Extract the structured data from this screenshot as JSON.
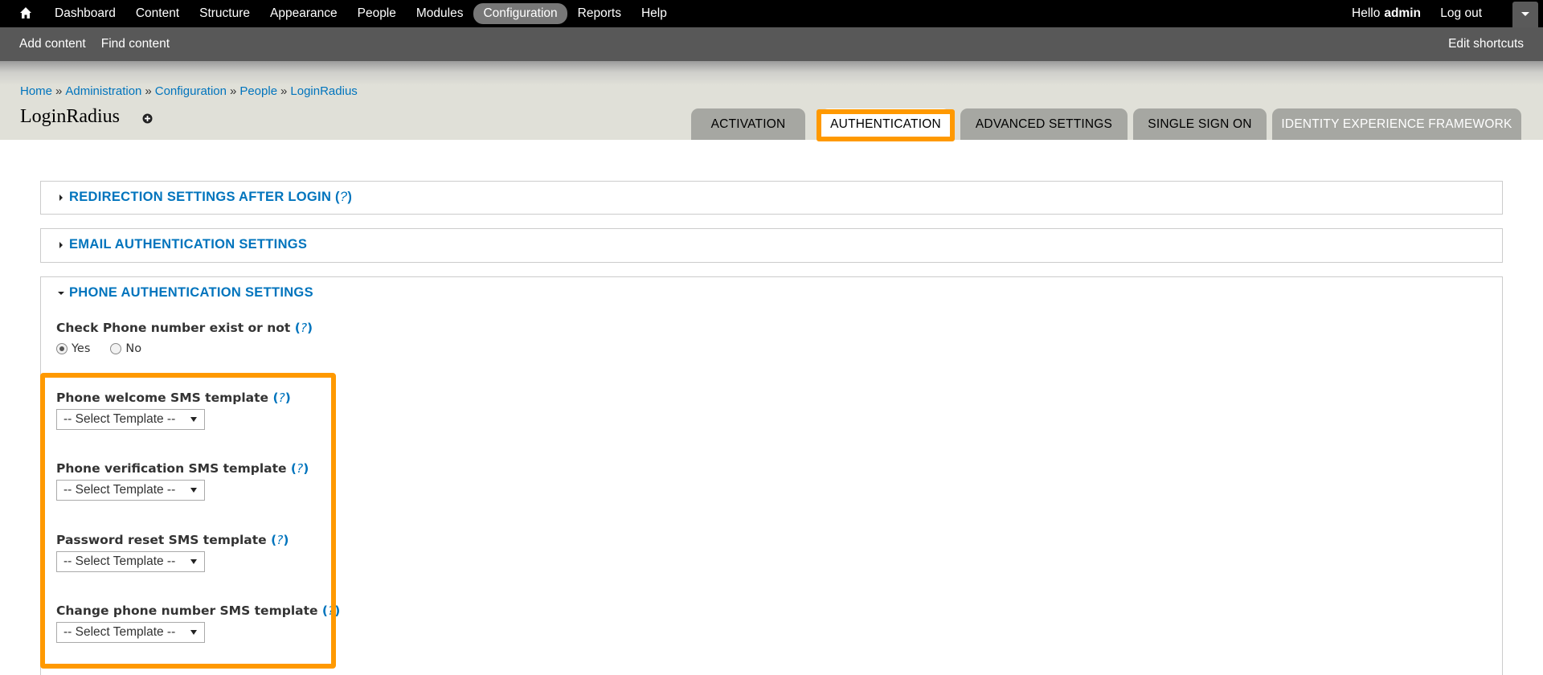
{
  "toolbar": {
    "nav": [
      "Dashboard",
      "Content",
      "Structure",
      "Appearance",
      "People",
      "Modules",
      "Configuration",
      "Reports",
      "Help"
    ],
    "active": "Configuration",
    "hello": "Hello",
    "username": "admin",
    "logout": "Log out"
  },
  "shortcuts": {
    "add_content": "Add content",
    "find_content": "Find content",
    "edit_shortcuts": "Edit shortcuts"
  },
  "breadcrumb": {
    "items": [
      "Home",
      "Administration",
      "Configuration",
      "People",
      "LoginRadius"
    ],
    "separator": "»"
  },
  "page_title": "LoginRadius",
  "tabs": [
    "ACTIVATION",
    "AUTHENTICATION",
    "ADVANCED SETTINGS",
    "SINGLE SIGN ON",
    "IDENTITY EXPERIENCE FRAMEWORK"
  ],
  "active_tab": "AUTHENTICATION",
  "sections": {
    "redirection": "REDIRECTION SETTINGS AFTER LOGIN",
    "email": "EMAIL AUTHENTICATION SETTINGS",
    "phone": "PHONE AUTHENTICATION SETTINGS"
  },
  "help_marker": "?",
  "phone": {
    "check_label": "Check Phone number exist or not",
    "yes": "Yes",
    "no": "No",
    "selected": "Yes",
    "welcome_label": "Phone welcome SMS template",
    "verification_label": "Phone verification SMS template",
    "reset_label": "Password reset SMS template",
    "change_label": "Change phone number SMS template",
    "select_placeholder": "-- Select Template --"
  },
  "colors": {
    "link": "#0074bd",
    "highlight": "#ff9900",
    "toolbar": "#000000",
    "shortcut_bar": "#585858",
    "active_nav": "#777777"
  }
}
